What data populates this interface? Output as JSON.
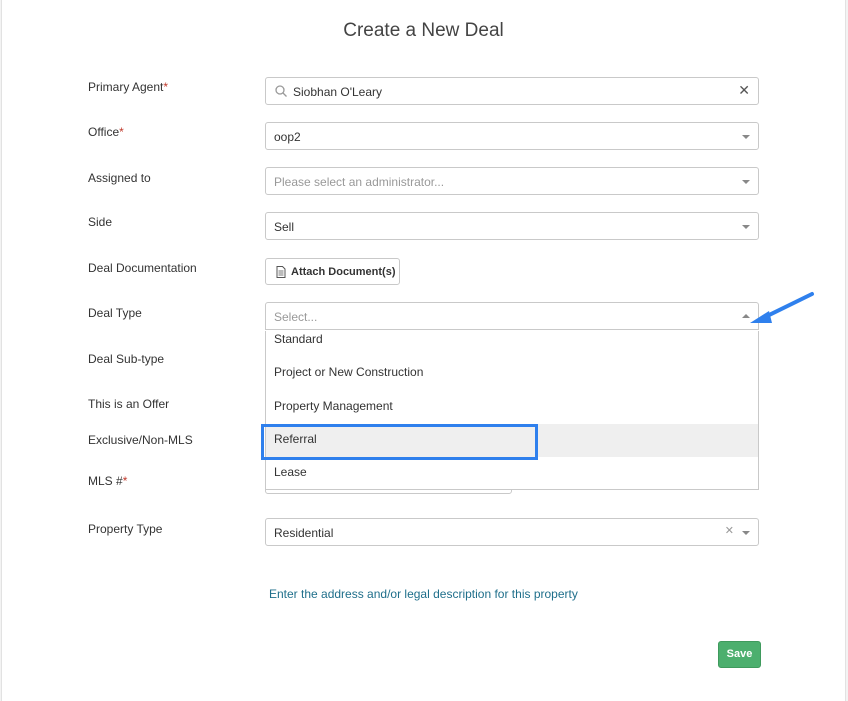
{
  "page": {
    "title": "Create a New Deal"
  },
  "form": {
    "primary_agent": {
      "label": "Primary Agent",
      "value": "Siobhan O'Leary"
    },
    "office": {
      "label": "Office",
      "value": "oop2"
    },
    "assigned_to": {
      "label": "Assigned to",
      "placeholder": "Please select an administrator..."
    },
    "side": {
      "label": "Side",
      "value": "Sell"
    },
    "deal_documentation": {
      "label": "Deal Documentation",
      "button_label": "Attach Document(s)"
    },
    "deal_type": {
      "label": "Deal Type",
      "placeholder": "Select...",
      "options": [
        "Standard",
        "Project or New Construction",
        "Property Management",
        "Referral",
        "Lease"
      ],
      "highlighted_option": "Referral"
    },
    "deal_sub_type": {
      "label": "Deal Sub-type"
    },
    "offer": {
      "label": "This is an Offer"
    },
    "exclusive": {
      "label": "Exclusive/Non-MLS"
    },
    "mls": {
      "label": "MLS #"
    },
    "property_type": {
      "label": "Property Type",
      "value": "Residential"
    },
    "required_marker": "*",
    "address_link": "Enter the address and/or legal description for this property",
    "save_label": "Save"
  },
  "icons": {
    "search": "search-icon",
    "clear": "close-icon",
    "document": "document-icon",
    "caret": "chevron-down-icon",
    "annotation_arrow": "arrow-icon"
  },
  "colors": {
    "save_button": "#4caf6e",
    "link": "#1f6f8b",
    "highlight": "#2f80ed",
    "required": "#c0392b"
  }
}
